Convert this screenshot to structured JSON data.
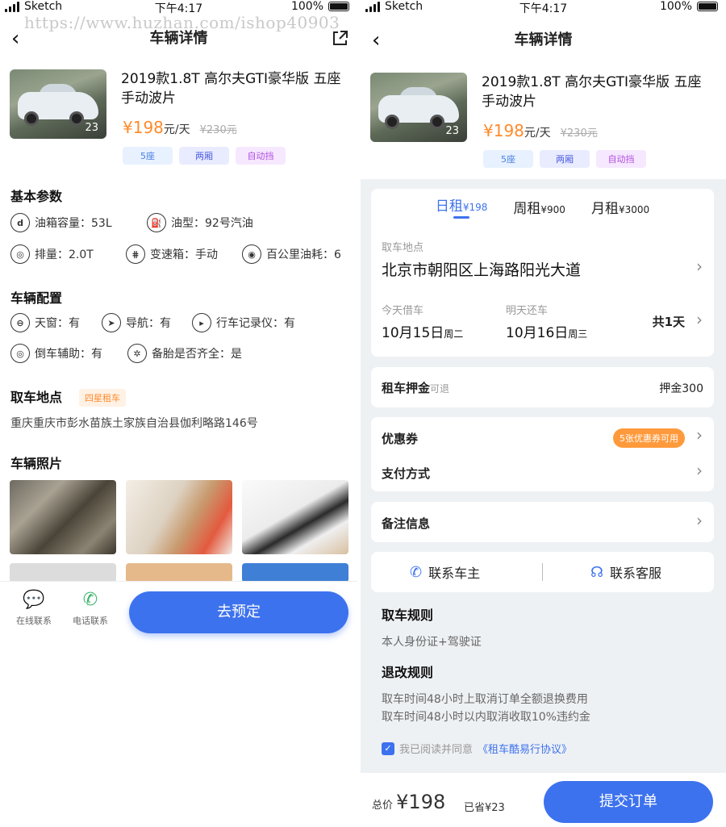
{
  "watermark": "https://www.huzhan.com/ishop40903",
  "status": {
    "carrier": "Sketch",
    "time": "下午4:17",
    "battery": "100%"
  },
  "left": {
    "nav_title": "车辆详情",
    "car": {
      "title": "2019款1.8T  高尔夫GTI豪华版  五座 手动波片",
      "photo_count": "23",
      "price": "¥198",
      "unit": "元/天",
      "old_price": "¥230元",
      "tags": [
        "5座",
        "两厢",
        "自动挡"
      ]
    },
    "basic_title": "基本参数",
    "basic": [
      {
        "icon": "fuel-tank-icon",
        "text": "油箱容量：53L"
      },
      {
        "icon": "fuel-pump-icon",
        "text": "油型：92号汽油"
      },
      {
        "icon": "engine-icon",
        "text": "排量：2.0T"
      },
      {
        "icon": "gearbox-icon",
        "text": "变速箱：手动"
      },
      {
        "icon": "consumption-icon",
        "text": "百公里油耗：6"
      }
    ],
    "config_title": "车辆配置",
    "config": [
      {
        "icon": "sunroof-icon",
        "text": "天窗：有"
      },
      {
        "icon": "navigation-icon",
        "text": "导航：有"
      },
      {
        "icon": "dashcam-icon",
        "text": "行车记录仪：有"
      },
      {
        "icon": "reverse-assist-icon",
        "text": "倒车辅助：有"
      },
      {
        "icon": "spare-tire-icon",
        "text": "备胎是否齐全：是"
      }
    ],
    "pickup_title": "取车地点",
    "pickup_badge": "四星租车",
    "pickup_address": "重庆重庆市彭水苗族土家族自治县伽利略路146号",
    "photos_title": "车辆照片",
    "bottom": {
      "chat": "在线联系",
      "phone": "电话联系",
      "reserve": "去预定"
    }
  },
  "right": {
    "nav_title": "车辆详情",
    "car": {
      "title": "2019款1.8T  高尔夫GTI豪华版  五座 手动波片",
      "photo_count": "23",
      "price": "¥198",
      "unit": "元/天",
      "old_price": "¥230元",
      "tags": [
        "5座",
        "两厢",
        "自动挡"
      ]
    },
    "tabs": [
      {
        "label": "日租",
        "price": "¥198"
      },
      {
        "label": "周租",
        "price": "¥900"
      },
      {
        "label": "月租",
        "price": "¥3000"
      }
    ],
    "pickup_label": "取车地点",
    "pickup_value": "北京市朝阳区上海路阳光大道",
    "borrow_label": "今天借车",
    "borrow_date": "10月15日",
    "borrow_week": "周二",
    "return_label": "明天还车",
    "return_date": "10月16日",
    "return_week": "周三",
    "duration": "共1天",
    "deposit_label": "租车押金",
    "deposit_note": "可退",
    "deposit_value": "押金300",
    "coupon_label": "优惠券",
    "coupon_badge": "5张优惠券可用",
    "payment_label": "支付方式",
    "remark_label": "备注信息",
    "contact_owner": "联系车主",
    "contact_service": "联系客服",
    "rule1_title": "取车规则",
    "rule1_text": "本人身份证+驾驶证",
    "rule2_title": "退改规则",
    "rule2_line1": "取车时间48小时上取消订单全额退换费用",
    "rule2_line2": "取车时间48小时以内取消收取10%违约金",
    "agree_text": "我已阅读并同意",
    "agree_link": "《租车酷易行协议》",
    "total_label": "总价",
    "total_value": "¥198",
    "saved": "已省¥23",
    "submit": "提交订单"
  }
}
